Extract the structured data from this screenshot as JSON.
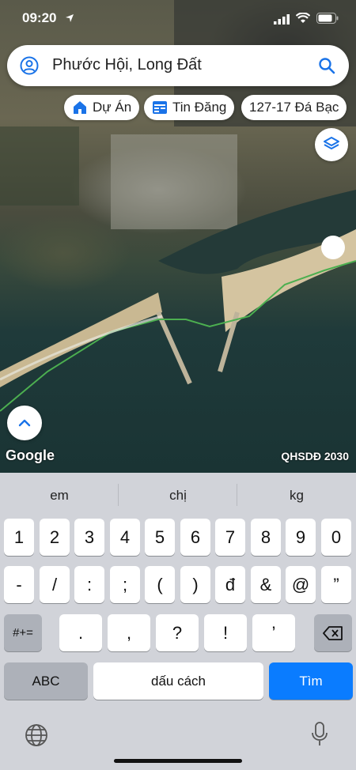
{
  "status_bar": {
    "time": "09:20"
  },
  "search": {
    "value": "Phước Hội, Long Đất"
  },
  "chips": [
    {
      "label": "Dự Án",
      "icon": "home-icon"
    },
    {
      "label": "Tin Đăng",
      "icon": "listing-icon"
    },
    {
      "label": "127-17 Đá Bạc",
      "icon": ""
    }
  ],
  "map": {
    "attribution": "Google",
    "overlay_label": "QHSDĐ 2030"
  },
  "keyboard": {
    "suggestions": [
      "em",
      "chị",
      "kg"
    ],
    "row1": [
      "1",
      "2",
      "3",
      "4",
      "5",
      "6",
      "7",
      "8",
      "9",
      "0"
    ],
    "row2": [
      "-",
      "/",
      ":",
      ";",
      "(",
      ")",
      "đ",
      "&",
      "@",
      "”"
    ],
    "row3": [
      "#+=",
      ".",
      ",",
      "?",
      "!",
      "’"
    ],
    "abc_label": "ABC",
    "space_label": "dấu cách",
    "return_label": "Tìm"
  },
  "colors": {
    "accent": "#1a73e8",
    "return_key": "#0a7cff",
    "boundary_line": "#4caf50"
  }
}
